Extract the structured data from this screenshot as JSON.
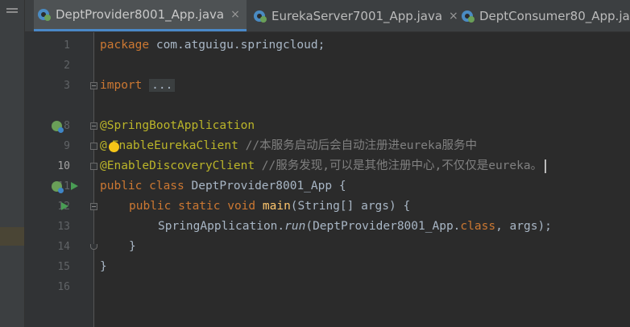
{
  "tabs": [
    {
      "label": "DeptProvider8001_App.java",
      "active": true,
      "close": "×"
    },
    {
      "label": "EurekaServer7001_App.java",
      "active": false,
      "close": "×"
    },
    {
      "label": "DeptConsumer80_App.java",
      "active": false,
      "close": ""
    }
  ],
  "line_numbers": [
    "1",
    "2",
    "3",
    "8",
    "9",
    "10",
    "11",
    "12",
    "13",
    "14",
    "15",
    "16"
  ],
  "current_line": "10",
  "code": {
    "l1_kw": "package",
    "l1_rest": " com.atguigu.springcloud;",
    "l3_kw": "import",
    "l3_fold": "...",
    "l8": "@SpringBootApplication",
    "l9_a": "@",
    "l9_ann": "EnableEurekaClient",
    "l9_comment": " //本服务启动后会自动注册进eureka服务中",
    "l10_ann": "@EnableDiscoveryClient",
    "l10_comment": " //服务发现,可以是其他注册中心,不仅仅是eureka。",
    "l11_kw": "public class",
    "l11_rest": " DeptProvider8001_App {",
    "l12_kw": "public static void",
    "l12_fn": "main",
    "l12_rest": "(String[] args) {",
    "l13_a": "SpringApplication.",
    "l13_run": "run",
    "l13_b": "(DeptProvider8001_App.",
    "l13_kw": "class",
    "l13_c": ", args);",
    "l14": "}",
    "l15": "}"
  },
  "colors": {
    "background": "#2b2b2b",
    "gutter": "#313335",
    "keyword": "#cc7832",
    "annotation": "#bbb529",
    "method": "#ffc66d",
    "comment": "#808080",
    "text": "#a9b7c6",
    "active_tab_underline": "#4a88c7"
  },
  "icons": {
    "tab_icon": "spring-java-class-icon",
    "gutter_bean": "spring-bean-icon",
    "gutter_run": "run-arrow-icon",
    "intention": "lightbulb-icon"
  }
}
